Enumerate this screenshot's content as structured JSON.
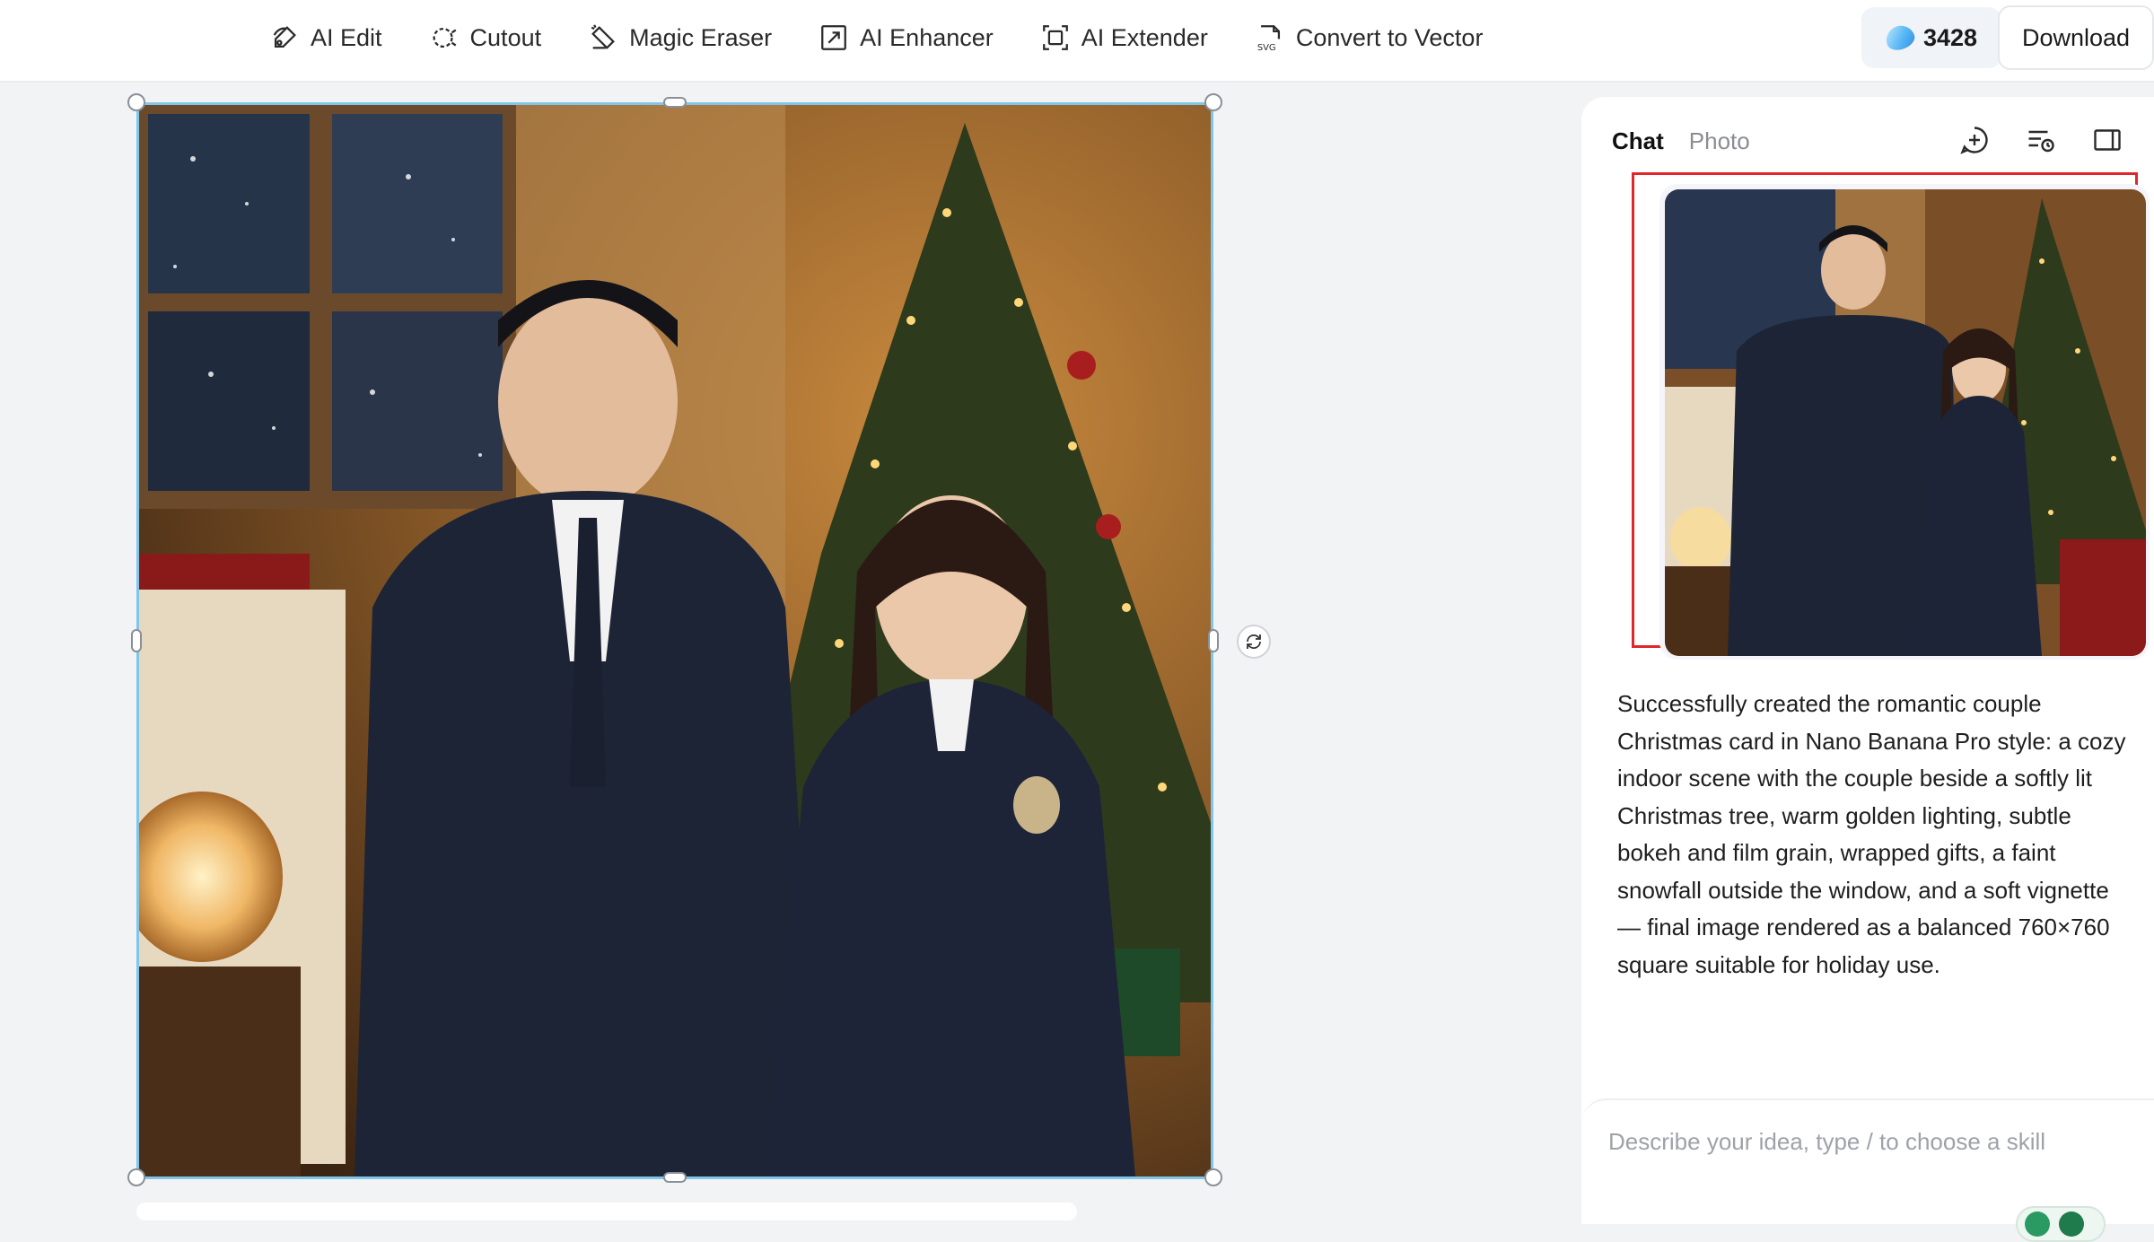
{
  "toolbar": {
    "tools": [
      {
        "label": "AI Edit",
        "icon": "ai-edit-icon"
      },
      {
        "label": "Cutout",
        "icon": "cutout-icon"
      },
      {
        "label": "Magic Eraser",
        "icon": "eraser-icon"
      },
      {
        "label": "AI Enhancer",
        "icon": "enhancer-icon"
      },
      {
        "label": "AI Extender",
        "icon": "extender-icon"
      },
      {
        "label": "Convert to Vector",
        "icon": "svg-icon"
      }
    ],
    "credits": "3428",
    "download_label": "Download"
  },
  "panel": {
    "tabs": [
      {
        "label": "Chat",
        "active": true
      },
      {
        "label": "Photo",
        "active": false
      }
    ],
    "icons": [
      "new-chat-icon",
      "history-icon",
      "sidebar-toggle-icon"
    ],
    "message": "Successfully created the romantic couple Christmas card in Nano Banana Pro style: a cozy indoor scene with the couple beside a softly lit Christmas tree, warm golden lighting, subtle bokeh and film grain, wrapped gifts, a faint snowfall outside the window, and a soft vignette — final image rendered as a balanced 760×760 square suitable for holiday use.",
    "input_placeholder": "Describe your idea, type / to choose a skill",
    "highlight_color": "#e0262b"
  },
  "canvas": {
    "selection_color": "#7fc6ea"
  }
}
